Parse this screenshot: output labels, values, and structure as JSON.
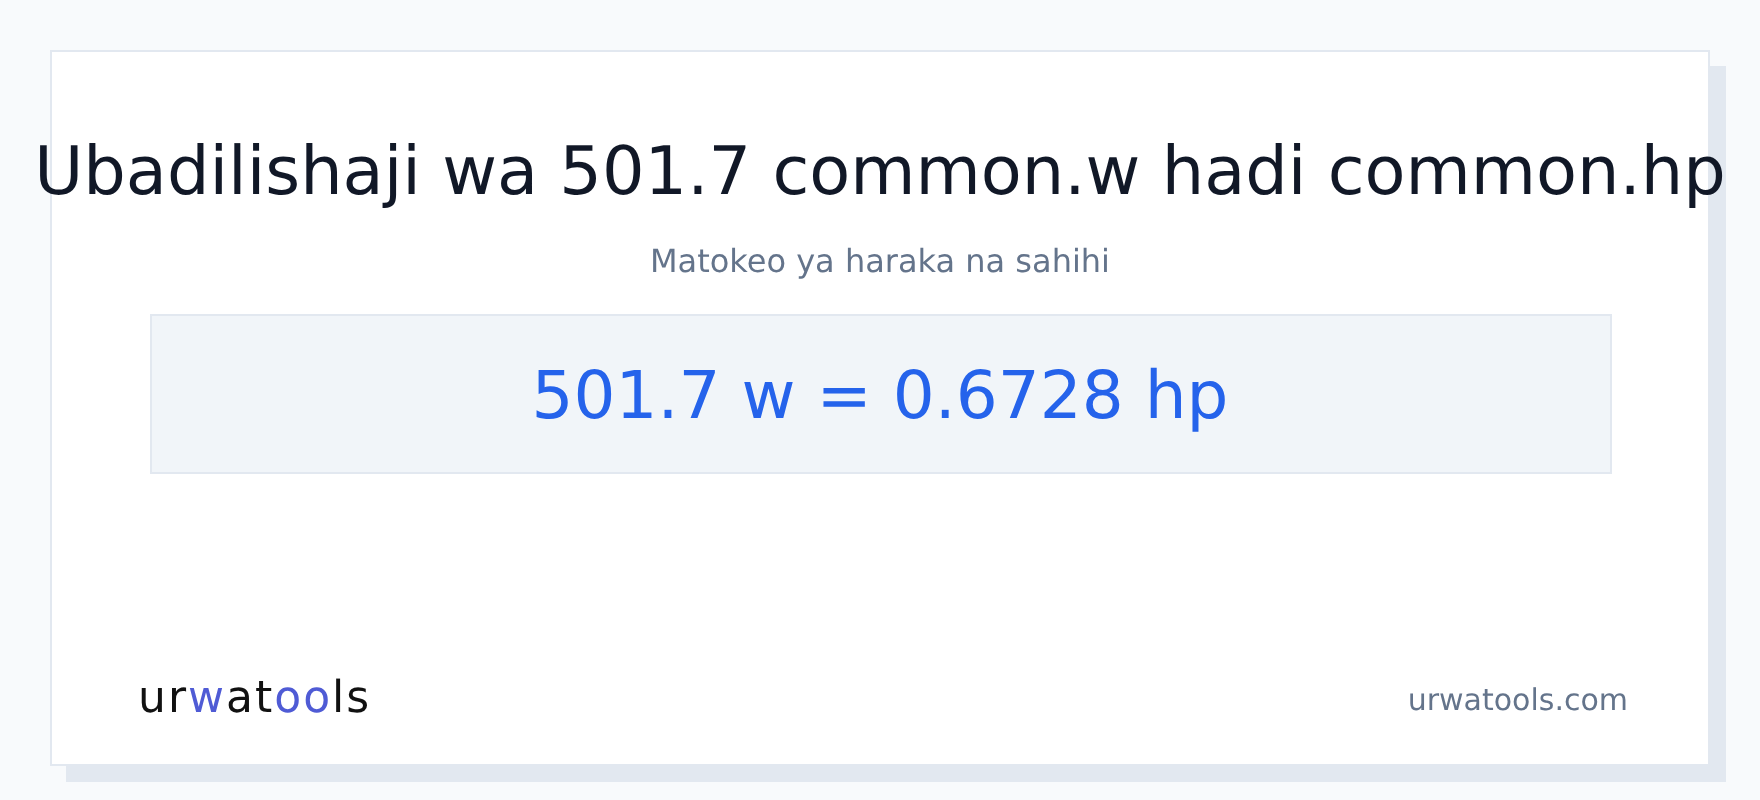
{
  "title": "Ubadilishaji wa 501.7 common.w hadi common.hp",
  "subtitle": "Matokeo ya haraka na sahihi",
  "result": "501.7 w = 0.6728 hp",
  "logo": [
    {
      "text": "ur",
      "accent": false
    },
    {
      "text": "w",
      "accent": true
    },
    {
      "text": "at",
      "accent": false
    },
    {
      "text": "oo",
      "accent": true
    },
    {
      "text": "ls",
      "accent": false
    }
  ],
  "site": "urwatools.com"
}
